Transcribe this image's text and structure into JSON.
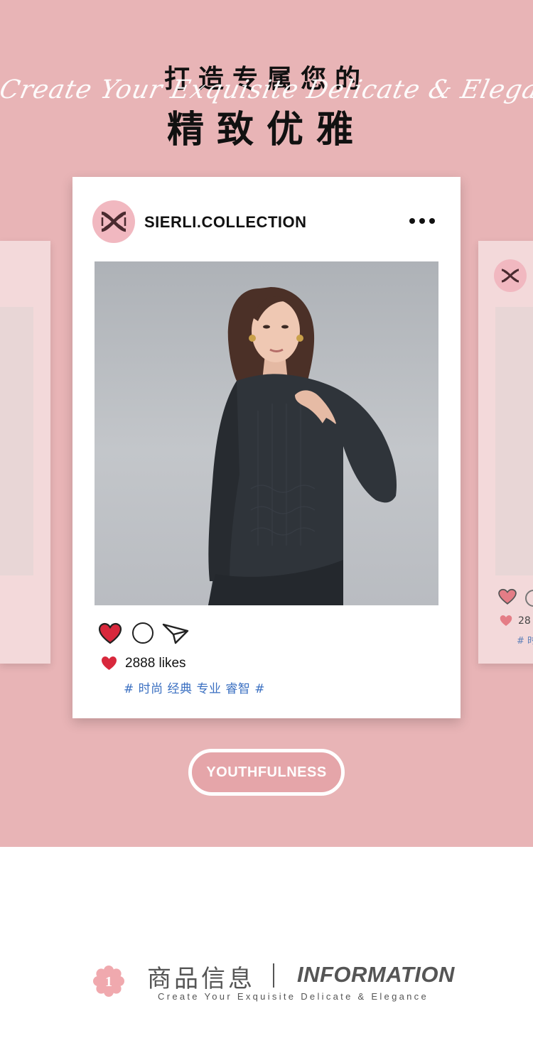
{
  "header": {
    "line1": "打造专属您的",
    "script": "Create Your Exquisite Delicate & Elegance",
    "line2": "精致优雅"
  },
  "post": {
    "brand_name": "SIERLI.COLLECTION",
    "likes_text": "2888 likes",
    "tags": "# 时尚 经典 专业 睿智 #",
    "more_icon": "more-dots-icon",
    "actions": [
      "heart-icon",
      "comment-icon",
      "share-icon"
    ]
  },
  "side_post": {
    "likes_text": "28",
    "tags": "# 时"
  },
  "badge": {
    "label": "YOUTHFULNESS"
  },
  "info": {
    "number": "1",
    "title_cn": "商品信息",
    "title_en": "INFORMATION",
    "subtitle": "Create Your Exquisite Delicate & Elegance"
  },
  "colors": {
    "background": "#e8b4b6",
    "card": "#ffffff",
    "heart": "#d8283c",
    "tags": "#3a6fc1",
    "accent_pink": "#f1b8c0"
  }
}
